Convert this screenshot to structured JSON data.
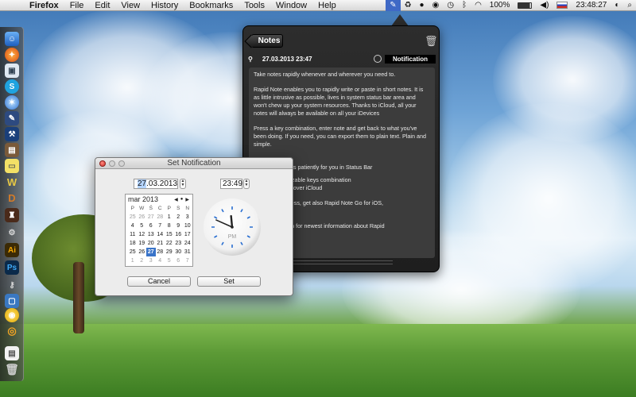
{
  "menubar": {
    "app_name": "Firefox",
    "menus": [
      "File",
      "Edit",
      "View",
      "History",
      "Bookmarks",
      "Tools",
      "Window",
      "Help"
    ],
    "battery": "100%",
    "time": "23:48:27"
  },
  "notes_panel": {
    "back_label": "Notes",
    "date": "27.03.2013 23:47",
    "notification_label": "Notification",
    "body": {
      "p1": "Take notes rapidly whenever and wherever you need to.",
      "p2": "Rapid Note enables you to rapidly write or paste in short notes. It is as little intrusive as possible, lives in system status bar area and won't chew up your system resources. Thanks to iCloud, all your notes will always be available on all your iDevices",
      "p3": "Press a key combination, enter note and get back to what you've been doing. If you need, you can export them to plain text. Plain and simple.",
      "features_title": "Features:",
      "f1": "- Lives and waits patiently for you in Status Bar",
      "f2": "...tly to customizable keys combination",
      "f3": "...automatically over iCloud",
      "f4": "...e awesomeness, get also Rapid Note Go for iOS,",
      "f5": "...obile sidekick",
      "f6": "...gnedbyte.com for newest information about Rapid"
    }
  },
  "dialog": {
    "title": "Set Notification",
    "date_day": "27",
    "date_rest": ".03.2013",
    "time": "23:49",
    "calendar": {
      "month": "mar 2013",
      "weekdays": [
        "P",
        "W",
        "Ś",
        "C",
        "P",
        "S",
        "N"
      ],
      "days": [
        {
          "d": "25",
          "dim": true
        },
        {
          "d": "26",
          "dim": true
        },
        {
          "d": "27",
          "dim": true
        },
        {
          "d": "28",
          "dim": true
        },
        {
          "d": "1"
        },
        {
          "d": "2"
        },
        {
          "d": "3"
        },
        {
          "d": "4"
        },
        {
          "d": "5"
        },
        {
          "d": "6"
        },
        {
          "d": "7"
        },
        {
          "d": "8"
        },
        {
          "d": "9"
        },
        {
          "d": "10"
        },
        {
          "d": "11"
        },
        {
          "d": "12"
        },
        {
          "d": "13"
        },
        {
          "d": "14"
        },
        {
          "d": "15"
        },
        {
          "d": "16"
        },
        {
          "d": "17"
        },
        {
          "d": "18"
        },
        {
          "d": "19"
        },
        {
          "d": "20"
        },
        {
          "d": "21"
        },
        {
          "d": "22"
        },
        {
          "d": "23"
        },
        {
          "d": "24"
        },
        {
          "d": "25"
        },
        {
          "d": "26"
        },
        {
          "d": "27",
          "sel": true
        },
        {
          "d": "28"
        },
        {
          "d": "29"
        },
        {
          "d": "30"
        },
        {
          "d": "31"
        },
        {
          "d": "1",
          "dim": true
        },
        {
          "d": "2",
          "dim": true
        },
        {
          "d": "3",
          "dim": true
        },
        {
          "d": "4",
          "dim": true
        },
        {
          "d": "5",
          "dim": true
        },
        {
          "d": "6",
          "dim": true
        },
        {
          "d": "7",
          "dim": true
        }
      ]
    },
    "clock": {
      "hour": 23,
      "minute": 49,
      "period": "PM"
    },
    "cancel_label": "Cancel",
    "set_label": "Set"
  },
  "dock_icons": [
    "finder-icon",
    "firefox-icon",
    "preview-icon",
    "skype-icon",
    "safari-icon",
    "notes-icon",
    "xcode-icon",
    "photo-icon",
    "stickies-icon",
    "wiki-icon",
    "dictionary-icon",
    "game-icon",
    "steam-icon",
    "illustrator-icon",
    "photoshop-icon",
    "tool-icon",
    "monitor-icon",
    "adium-icon",
    "blender-icon",
    "document-icon",
    "trash-icon"
  ]
}
